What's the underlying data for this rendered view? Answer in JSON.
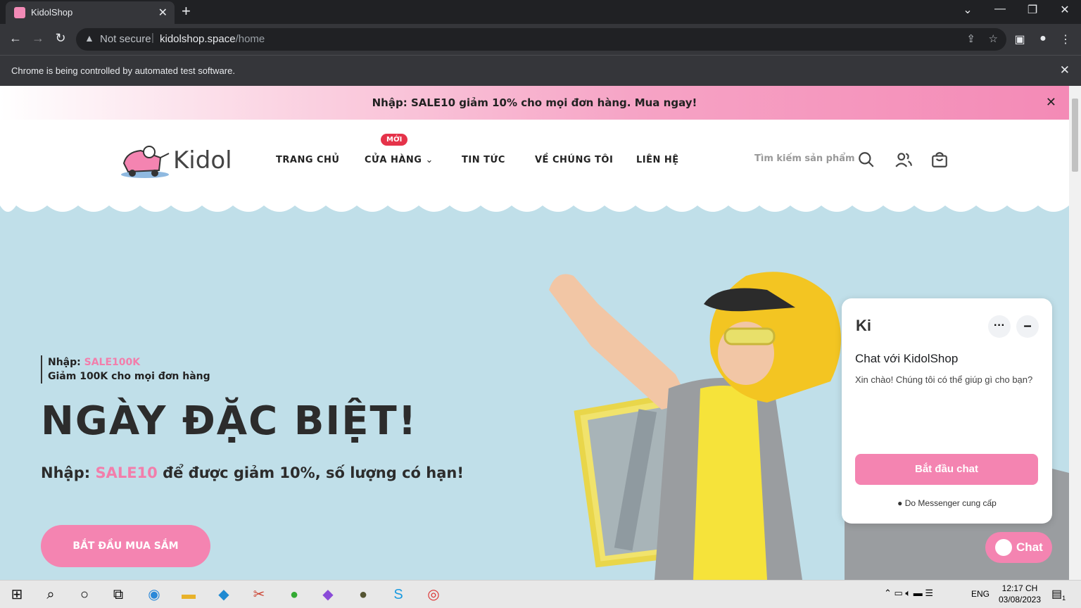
{
  "browser": {
    "tab_title": "KidolShop",
    "tab_close": "✕",
    "new_tab": "+",
    "security_label": "Not secure",
    "url_host": "kidolshop.space",
    "url_path": "/home",
    "infobar_text": "Chrome is being controlled by automated test software.",
    "infobar_close": "✕"
  },
  "promo": {
    "text": "Nhập: SALE10 giảm 10% cho mọi đơn hàng. Mua ngay!",
    "close": "✕"
  },
  "header": {
    "logo_text": "Kidol",
    "nav": [
      "TRANG CHỦ",
      "CỬA HÀNG",
      "TIN TỨC",
      "VỀ CHÚNG TÔI",
      "LIÊN HỆ"
    ],
    "new_badge": "MỚI",
    "search_placeholder": "Tìm kiếm sản phẩm"
  },
  "hero": {
    "code_label": "Nhập: ",
    "code_value": "SALE100K",
    "code_desc": "Giảm 100K cho mọi đơn hàng",
    "title": "NGÀY ĐẶC BIỆT!",
    "sub_prefix": "Nhập: ",
    "sub_code": "SALE10",
    "sub_suffix": " để được giảm 10%, số lượng có hạn!",
    "cta": "BẮT ĐẦU MUA SẮM"
  },
  "chat": {
    "logo": "Ki",
    "title": "Chat với KidolShop",
    "message": "Xin chào! Chúng tôi có thể giúp gì cho bạn?",
    "start_button": "Bắt đầu chat",
    "provided_by": "Do Messenger cung cấp",
    "chat_button": "Chat"
  },
  "taskbar": {
    "lang": "ENG",
    "time": "12:17 CH",
    "date": "03/08/2023",
    "notification_count": "1"
  },
  "colors": {
    "pink": "#f484b1",
    "hero_bg": "#c0dfe9",
    "badge_red": "#e5334a"
  }
}
